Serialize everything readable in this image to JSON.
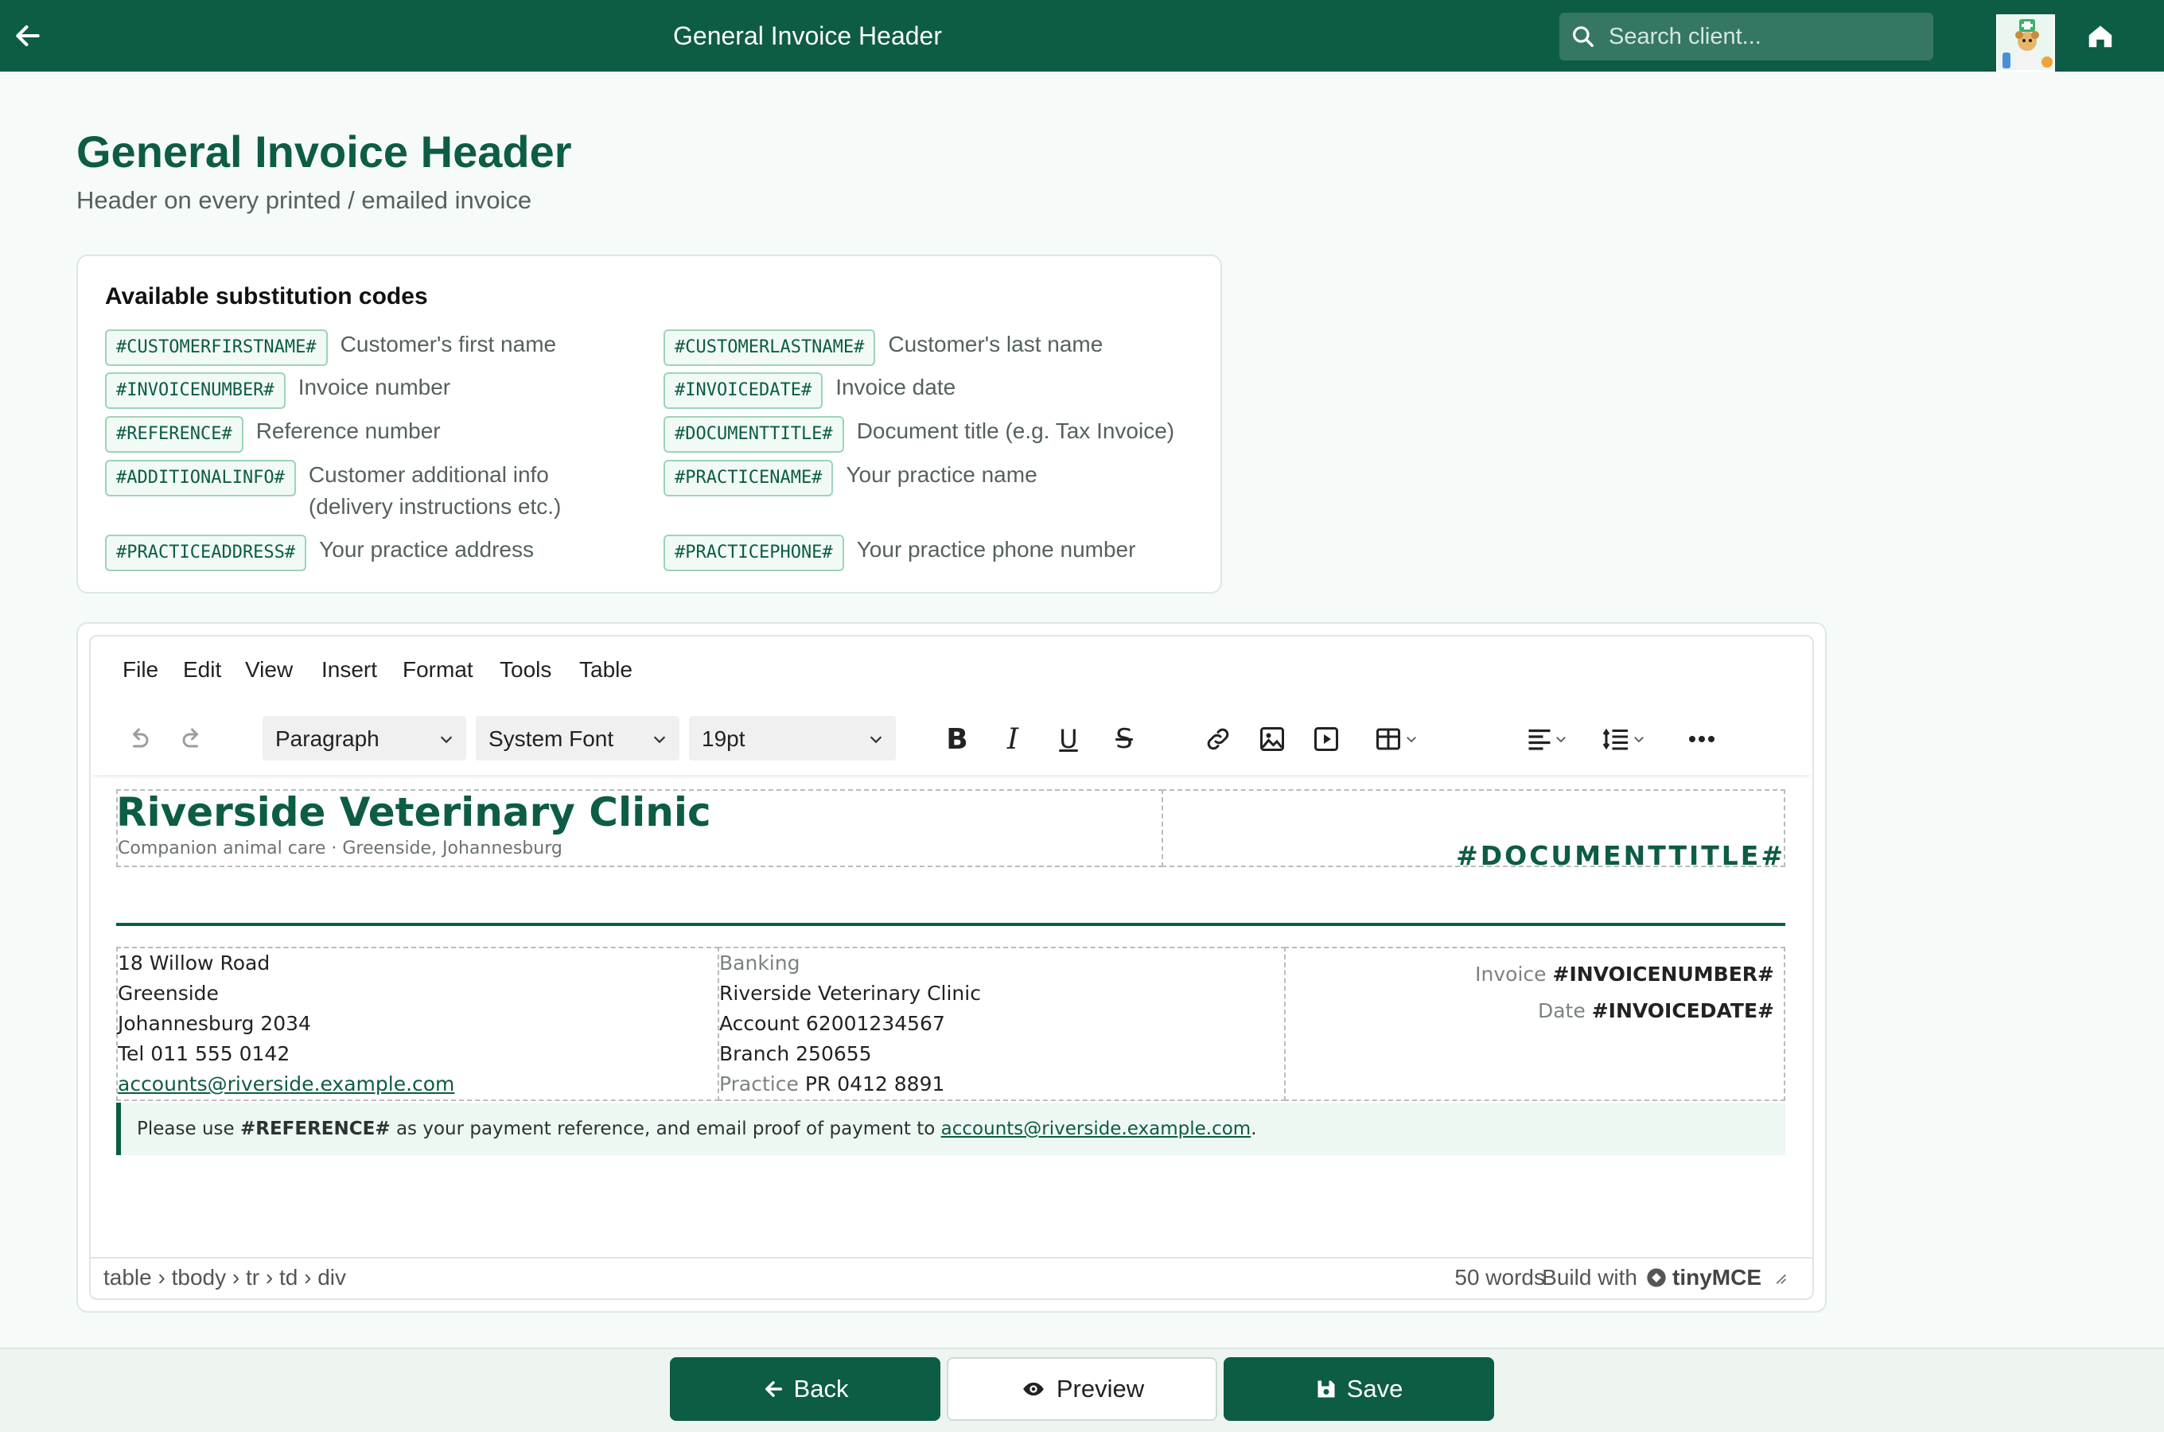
{
  "topbar": {
    "title": "General Invoice Header",
    "search_placeholder": "Search client..."
  },
  "page": {
    "title": "General Invoice Header",
    "subtitle": "Header on every printed / emailed invoice"
  },
  "codes": {
    "heading": "Available substitution codes",
    "items": [
      {
        "code": "#CUSTOMERFIRSTNAME#",
        "desc": "Customer's first name"
      },
      {
        "code": "#CUSTOMERLASTNAME#",
        "desc": "Customer's last name"
      },
      {
        "code": "#INVOICENUMBER#",
        "desc": "Invoice number"
      },
      {
        "code": "#INVOICEDATE#",
        "desc": "Invoice date"
      },
      {
        "code": "#REFERENCE#",
        "desc": "Reference number"
      },
      {
        "code": "#DOCUMENTTITLE#",
        "desc": "Document title (e.g. Tax Invoice)"
      },
      {
        "code": "#ADDITIONALINFO#",
        "desc": "Customer additional info (delivery instructions etc.)"
      },
      {
        "code": "#PRACTICENAME#",
        "desc": "Your practice name"
      },
      {
        "code": "#PRACTICEADDRESS#",
        "desc": "Your practice address"
      },
      {
        "code": "#PRACTICEPHONE#",
        "desc": "Your practice phone number"
      }
    ]
  },
  "editor": {
    "menus": [
      "File",
      "Edit",
      "View",
      "Insert",
      "Format",
      "Tools",
      "Table"
    ],
    "block_format": "Paragraph",
    "font_family": "System Font",
    "font_size": "19pt",
    "status_path": "table › tbody › tr › td › div",
    "word_count": "50 words",
    "build_with": "Build with",
    "brand": "tinyMCE"
  },
  "doc": {
    "clinic_name": "Riverside Veterinary Clinic",
    "tagline": "Companion animal care · Greenside, Johannesburg",
    "doc_title": "#DOCUMENTTITLE#",
    "address": [
      "18 Willow Road",
      "Greenside",
      "Johannesburg 2034",
      "Tel 011 555 0142"
    ],
    "email": "accounts@riverside.example.com",
    "banking_label": "Banking",
    "banking": [
      "Riverside Veterinary Clinic",
      "Account 62001234567",
      "Branch 250655"
    ],
    "practice_label": "Practice",
    "practice_number": "PR 0412 8891",
    "invoice_label": "Invoice",
    "invoice_code": "#INVOICENUMBER#",
    "date_label": "Date",
    "date_code": "#INVOICEDATE#",
    "note_pre": "Please use ",
    "note_code": "#REFERENCE#",
    "note_mid": " as your payment reference, and email proof of payment to ",
    "note_email": "accounts@riverside.example.com",
    "note_end": "."
  },
  "actions": {
    "back": "Back",
    "preview": "Preview",
    "save": "Save"
  },
  "colors": {
    "brand": "#0d5c45",
    "background": "#f6faf8"
  }
}
